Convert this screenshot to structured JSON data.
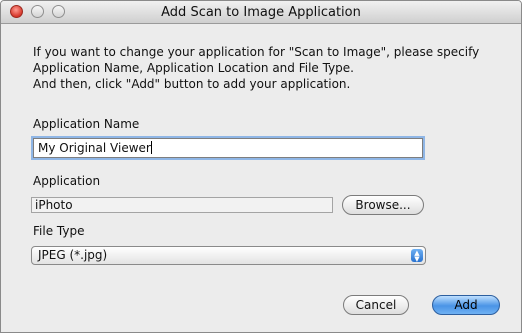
{
  "window": {
    "title": "Add Scan to Image Application"
  },
  "instructions": "If you want to change your application for \"Scan to Image\", please specify\nApplication Name, Application Location and File Type.\nAnd then, click \"Add\" button to add your application.",
  "app_name": {
    "label": "Application Name",
    "value": "My Original Viewer"
  },
  "application": {
    "label": "Application",
    "value": "iPhoto",
    "browse_label": "Browse..."
  },
  "file_type": {
    "label": "File Type",
    "selected": "JPEG (*.jpg)"
  },
  "buttons": {
    "cancel": "Cancel",
    "add": "Add"
  },
  "colors": {
    "accent": "#4a94e6",
    "close_button": "#d6372b",
    "focus_ring": "#8fb6e6"
  }
}
